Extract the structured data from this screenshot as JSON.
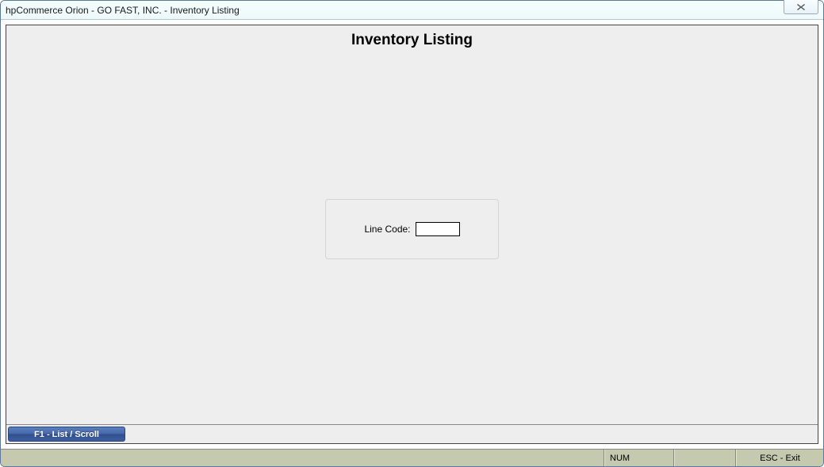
{
  "window": {
    "title": "hpCommerce Orion - GO FAST, INC. - Inventory Listing"
  },
  "page": {
    "heading": "Inventory Listing"
  },
  "form": {
    "line_code_label": "Line Code:",
    "line_code_value": ""
  },
  "toolbar": {
    "f1_label": "F1 - List / Scroll"
  },
  "statusbar": {
    "main": "",
    "num": "NUM",
    "exit": "ESC - Exit"
  }
}
